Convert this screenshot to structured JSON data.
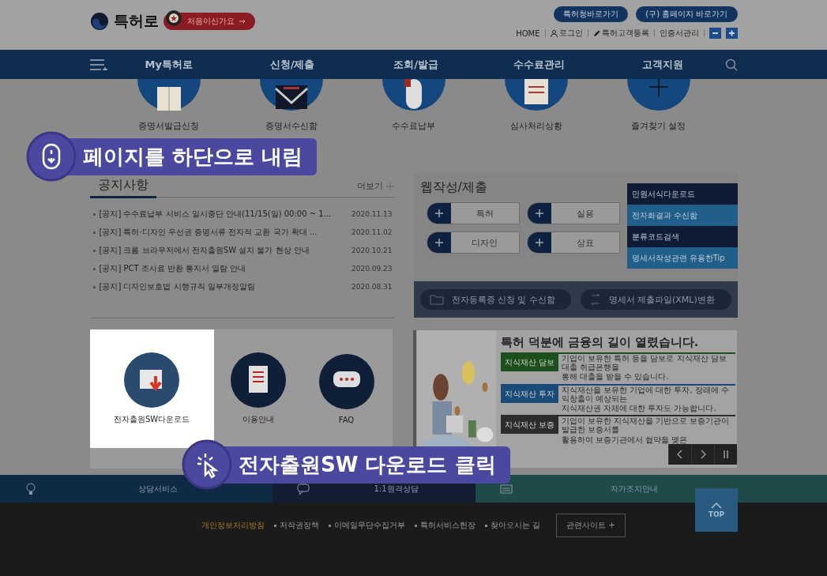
{
  "header": {
    "logo": "특허로",
    "first_visit": "처음이신가요",
    "top_buttons": [
      "특허청바로가기",
      "(구) 홈페이지 바로가기"
    ],
    "util_links": [
      {
        "label": "HOME",
        "kind": "plain"
      },
      {
        "label": "로그인",
        "kind": "person"
      },
      {
        "label": "특허고객등록",
        "kind": "pen"
      },
      {
        "label": "인증서관리",
        "kind": "plain"
      }
    ]
  },
  "nav": {
    "items": [
      "My특허로",
      "신청/제출",
      "조회/발급",
      "수수료관리",
      "고객지원"
    ]
  },
  "quick_links": [
    {
      "label": "증명서발급신청",
      "kind": "book"
    },
    {
      "label": "증명서수신함",
      "kind": "envelope"
    },
    {
      "label": "수수료납부",
      "kind": "mouse"
    },
    {
      "label": "심사처리상황",
      "kind": "scroll"
    },
    {
      "label": "즐겨찾기 설정",
      "kind": "plus"
    }
  ],
  "notices": {
    "title": "공지사항",
    "more": "더보기",
    "items": [
      {
        "text": "[공지] 수수료납부 서비스 일시중단 안내(11/15(일) 00:00 ~ 1...",
        "date": "2020.11.13"
      },
      {
        "text": "[공지] 특허·디자인 우선권 증명서류 전자적 교환 국가 확대 ...",
        "date": "2020.11.02"
      },
      {
        "text": "[공지] 크롬 브라우저에서 전자출원SW 설치 불가 현상 안내",
        "date": "2020.10.21"
      },
      {
        "text": "[공지] PCT 조사료 반환 통지서 열람 안내",
        "date": "2020.09.23"
      },
      {
        "text": "[공지] 디자인보호법 시행규칙 일부개정알림",
        "date": "2020.08.31"
      }
    ]
  },
  "web_submit": {
    "title": "웹작성/제출",
    "buttons": [
      "특허",
      "실용",
      "디자인",
      "상표"
    ],
    "side_menu": [
      {
        "label": "민원서식다운로드",
        "color": "#0f1c33"
      },
      {
        "label": "전자화결과 수신함",
        "color": "#1f5f8a"
      },
      {
        "label": "분류코드검색",
        "color": "#0f1c33"
      },
      {
        "label": "명세서작성관련 유용한Tip",
        "color": "#1f5f8a"
      }
    ],
    "bottom_buttons": [
      {
        "label": "전자등록증 신청 및 수신함",
        "kind": "folder"
      },
      {
        "label": "명세서 제출파일(XML)변환",
        "kind": "convert"
      }
    ]
  },
  "services": [
    {
      "label": "전자출원SW다운로드",
      "kind": "download",
      "highlighted": true
    },
    {
      "label": "이용안내",
      "kind": "doc",
      "highlighted": false
    },
    {
      "label": "FAQ",
      "kind": "chat",
      "highlighted": false
    }
  ],
  "banner": {
    "kind": "picture",
    "headline": "특허 덕분에 금융의 길이 열렸습니다.",
    "rows": [
      {
        "label": "지식재산 담보",
        "color": "#1c4f1c",
        "lines": [
          "기업이 보유한 특허 등을 담보로 지식재산 담보대출 취급은행을",
          "통해 대출을 받을 수 있습니다."
        ]
      },
      {
        "label": "지식재산 투자",
        "color": "#1a4a78",
        "lines": [
          "지식재산을 보유한 기업에 대한 투자, 장래에 수익창출이 예상되는",
          "지식재산권 자체에 대한 투자도 가능합니다."
        ]
      },
      {
        "label": "지식재산 보증",
        "color": "#2c2c2c",
        "lines": [
          "기업이 보유한 지식재산을 기반으로 보증기관이 발급한 보증서를",
          "활용하여 보증기관에서 협약을 맺은"
        ]
      }
    ]
  },
  "consult_bar": [
    {
      "label": "상담서비스",
      "kind": "bulb",
      "color": "#0e2a45"
    },
    {
      "label": "1:1원격상담",
      "kind": "chat",
      "color": "#121d33"
    },
    {
      "label": "자가조치안내",
      "kind": "keyboard",
      "color": "#1f4a4a"
    }
  ],
  "footer": {
    "links": [
      {
        "label": "개인정보처리방침",
        "emphasis": true
      },
      {
        "label": "저작권정책",
        "emphasis": false
      },
      {
        "label": "이메일무단수집거부",
        "emphasis": false
      },
      {
        "label": "특허서비스헌장",
        "emphasis": false
      },
      {
        "label": "찾아오시는 길",
        "emphasis": false
      }
    ],
    "related": "관련사이트 +"
  },
  "top_button": "TOP",
  "callouts": [
    {
      "text": "페이지를 하단으로 내림",
      "kind": "scroll"
    },
    {
      "text": "전자출원SW 다운로드 클릭",
      "kind": "click"
    }
  ]
}
